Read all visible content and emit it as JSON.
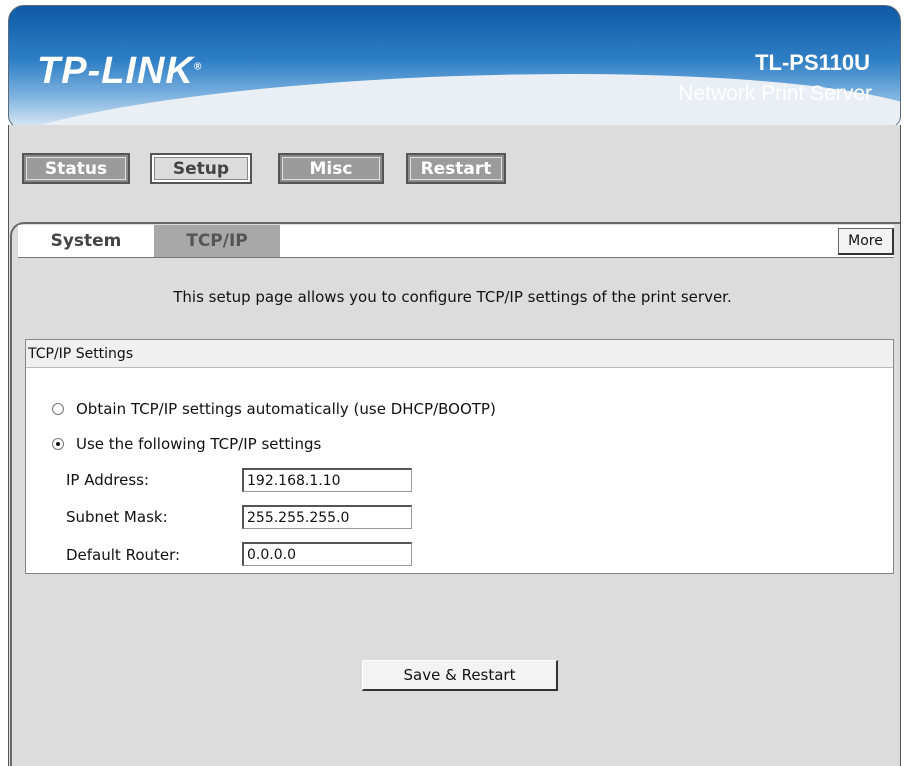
{
  "header": {
    "logo": "TP-LINK",
    "model": "TL-PS110U",
    "subtitle": "Network Print Server"
  },
  "nav": {
    "items": [
      {
        "label": "Status",
        "active": false
      },
      {
        "label": "Setup",
        "active": true
      },
      {
        "label": "Misc",
        "active": false
      },
      {
        "label": "Restart",
        "active": false
      }
    ]
  },
  "tabs": {
    "items": [
      {
        "label": "System",
        "active": false
      },
      {
        "label": "TCP/IP",
        "active": true
      }
    ],
    "more_label": "More"
  },
  "intro": "This setup page allows you to configure TCP/IP settings of the print server.",
  "settings": {
    "title": "TCP/IP Settings",
    "option_auto": "Obtain TCP/IP settings automatically (use DHCP/BOOTP)",
    "option_manual": "Use the following TCP/IP settings",
    "selected": "manual",
    "fields": {
      "ip_label": "IP Address:",
      "ip_value": "192.168.1.10",
      "mask_label": "Subnet Mask:",
      "mask_value": "255.255.255.0",
      "router_label": "Default Router:",
      "router_value": "0.0.0.0"
    }
  },
  "save_label": "Save & Restart"
}
